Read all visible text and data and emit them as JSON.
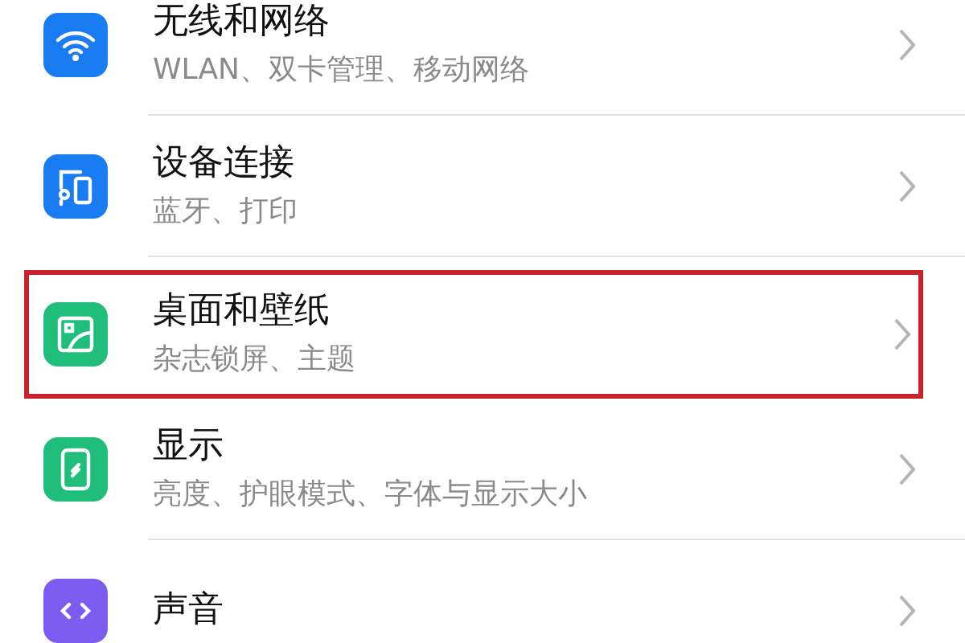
{
  "settings": [
    {
      "title": "无线和网络",
      "subtitle": "WLAN、双卡管理、移动网络",
      "highlighted": false
    },
    {
      "title": "设备连接",
      "subtitle": "蓝牙、打印",
      "highlighted": false
    },
    {
      "title": "桌面和壁纸",
      "subtitle": "杂志锁屏、主题",
      "highlighted": true
    },
    {
      "title": "显示",
      "subtitle": "亮度、护眼模式、字体与显示大小",
      "highlighted": false
    },
    {
      "title": "声音",
      "highlighted": false
    }
  ]
}
